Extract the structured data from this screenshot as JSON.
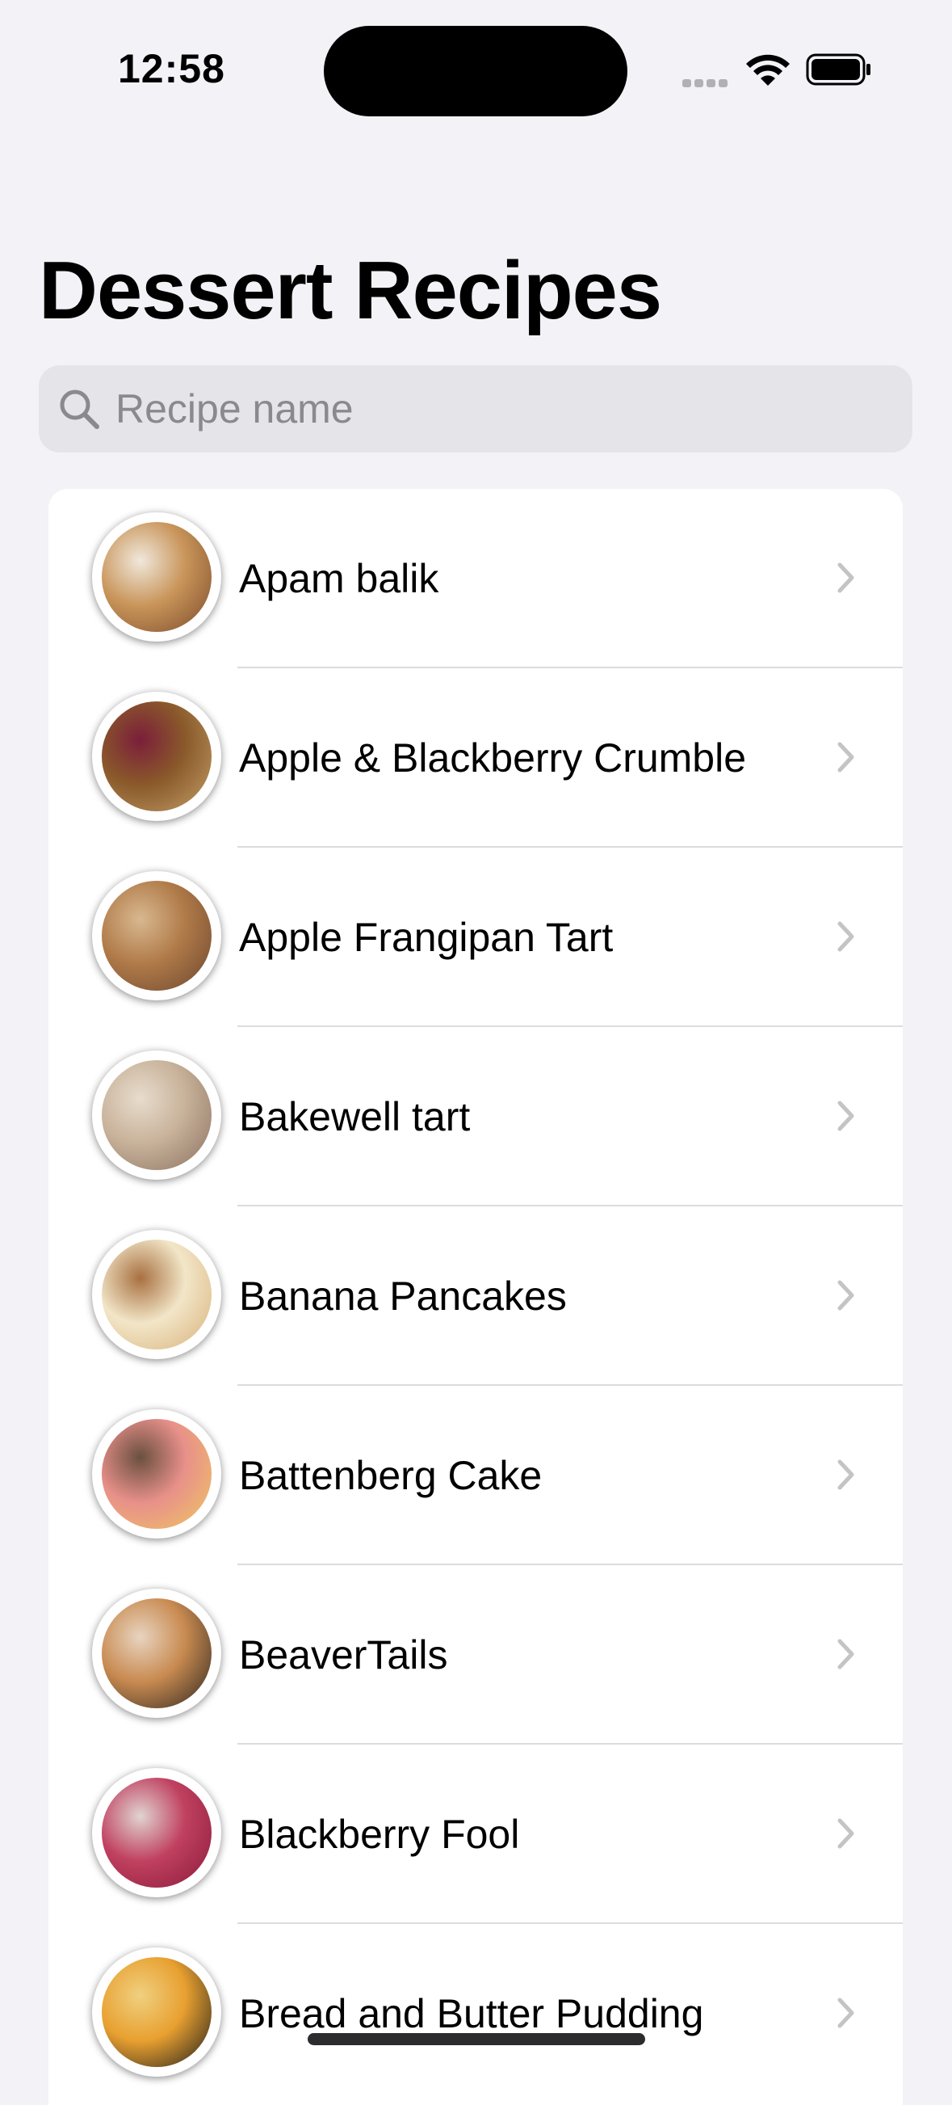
{
  "status_bar": {
    "time": "12:58",
    "icons": [
      "signal-dots-icon",
      "wifi-icon",
      "battery-icon"
    ]
  },
  "header": {
    "title": "Dessert Recipes"
  },
  "search": {
    "placeholder": "Recipe name",
    "value": "",
    "icon": "search-icon"
  },
  "recipes": [
    {
      "name": "Apam balik",
      "thumb_colors": [
        "#7a4a2a",
        "#c9955a",
        "#f0e8dc"
      ]
    },
    {
      "name": "Apple & Blackberry Crumble",
      "thumb_colors": [
        "#c4a06a",
        "#8a5a2a",
        "#7b1e3a"
      ]
    },
    {
      "name": "Apple Frangipan Tart",
      "thumb_colors": [
        "#6b4630",
        "#b07a48",
        "#d8b890"
      ]
    },
    {
      "name": "Bakewell tart",
      "thumb_colors": [
        "#8a7060",
        "#c8b29a",
        "#e8dccd"
      ]
    },
    {
      "name": "Banana Pancakes",
      "thumb_colors": [
        "#d8b078",
        "#f2e6c8",
        "#a87040"
      ]
    },
    {
      "name": "Battenberg Cake",
      "thumb_colors": [
        "#f0c860",
        "#e8908a",
        "#6a5040"
      ]
    },
    {
      "name": "BeaverTails",
      "thumb_colors": [
        "#2a2420",
        "#c88a50",
        "#e8d4c0"
      ]
    },
    {
      "name": "Blackberry Fool",
      "thumb_colors": [
        "#8a1a3a",
        "#c04060",
        "#e0d4d0"
      ]
    },
    {
      "name": "Bread and Butter Pudding",
      "thumb_colors": [
        "#1a1a1a",
        "#e8a030",
        "#f0d080"
      ]
    }
  ],
  "row_chevron_icon": "chevron-right-icon"
}
